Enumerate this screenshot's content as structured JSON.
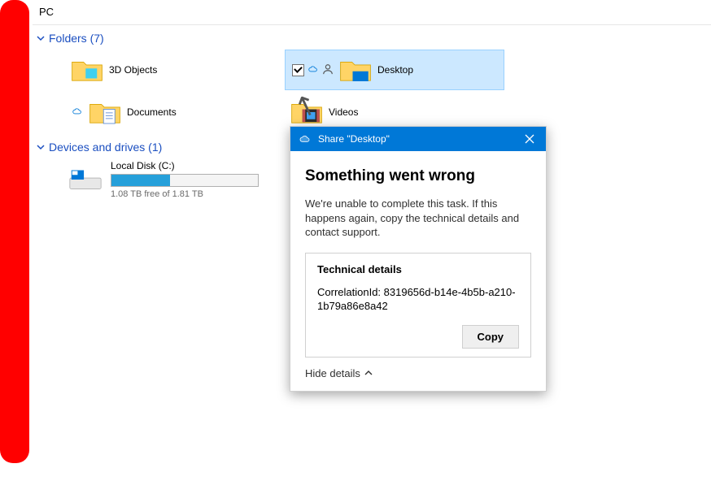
{
  "breadcrumb": {
    "current": "PC"
  },
  "sections": {
    "folders": {
      "title": "Folders",
      "count_label": "(7)"
    },
    "drives": {
      "title": "Devices and drives",
      "count_label": "(1)"
    }
  },
  "folders": [
    {
      "label": "3D Objects",
      "selected": false,
      "checked": false,
      "sync": false,
      "shared": false
    },
    {
      "label": "Desktop",
      "selected": true,
      "checked": true,
      "sync": true,
      "shared": true
    },
    {
      "label": "Documents",
      "selected": false,
      "checked": false,
      "sync": true,
      "shared": false
    },
    {
      "label": "Videos",
      "selected": false,
      "checked": false,
      "sync": false,
      "shared": false
    }
  ],
  "drive": {
    "label": "Local Disk (C:)",
    "free_text": "1.08 TB free of 1.81 TB",
    "fill_percent": 40
  },
  "dialog": {
    "title": "Share \"Desktop\"",
    "heading": "Something went wrong",
    "message": "We're unable to complete this task. If this happens again, copy the technical details and contact support.",
    "tech_heading": "Technical details",
    "tech_value": "CorrelationId: 8319656d-b14e-4b5b-a210-1b79a86e8a42",
    "copy_label": "Copy",
    "hide_label": "Hide details"
  }
}
